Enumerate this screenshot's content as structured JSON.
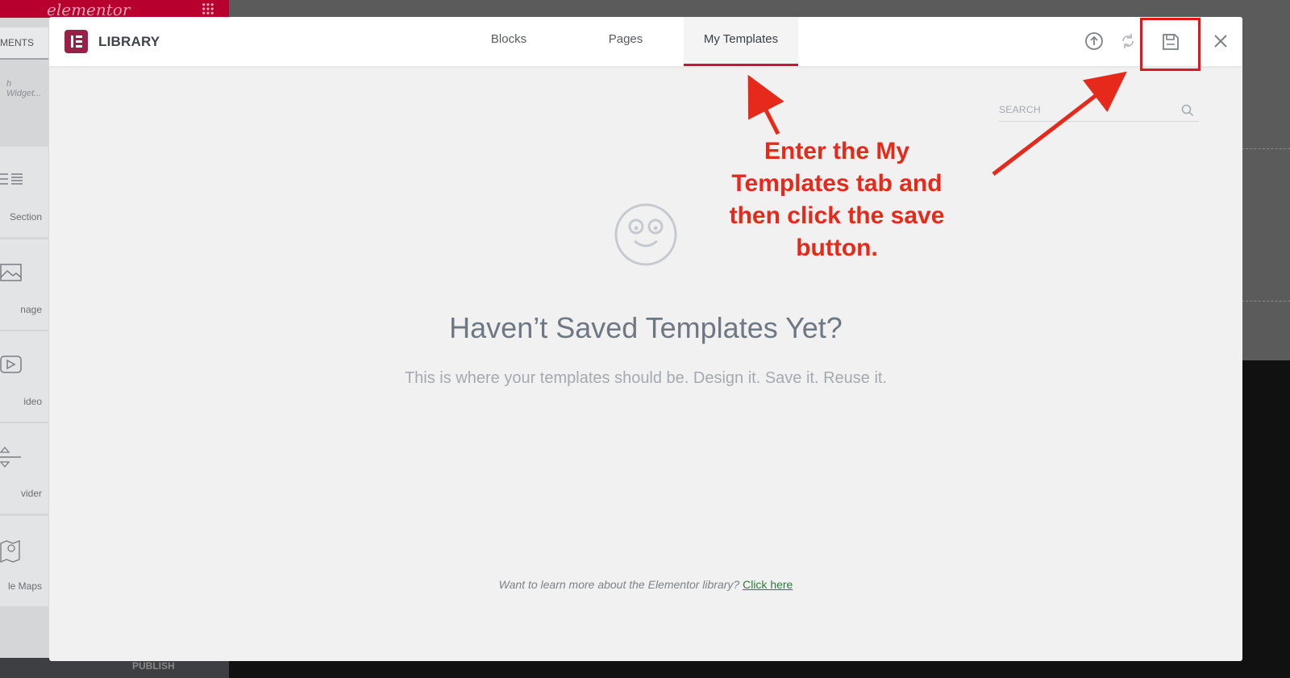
{
  "editor": {
    "logo": "elementor",
    "tab_label": "MENTS",
    "search_placeholder": "h Widget...",
    "widgets": [
      {
        "label": "Section"
      },
      {
        "label": "nage"
      },
      {
        "label": "ideo"
      },
      {
        "label": "vider"
      },
      {
        "label": "le Maps"
      }
    ],
    "publish_label": "PUBLISH"
  },
  "library": {
    "title": "LIBRARY",
    "tabs": [
      {
        "label": "Blocks",
        "active": false
      },
      {
        "label": "Pages",
        "active": false
      },
      {
        "label": "My Templates",
        "active": true
      }
    ],
    "header_icons": [
      "import-icon",
      "sync-icon",
      "save-icon",
      "close-icon"
    ],
    "search": {
      "placeholder": "SEARCH"
    },
    "empty_state": {
      "icon": "smiley-face-icon",
      "title": "Haven’t Saved Templates Yet?",
      "subtitle": "This is where your templates should be. Design it. Save it. Reuse it."
    },
    "footer": {
      "text": "Want to learn more about the Elementor library?",
      "link": "Click here"
    }
  },
  "annotation": {
    "lines": [
      "Enter the My",
      "Templates tab and",
      "then click the save",
      "button."
    ],
    "color": "#e5291a"
  },
  "colors": {
    "brand": "#9b1f47",
    "tab_active_underline": "#c3173d",
    "highlight_box": "#e5161b",
    "link": "#2e7a3a"
  }
}
